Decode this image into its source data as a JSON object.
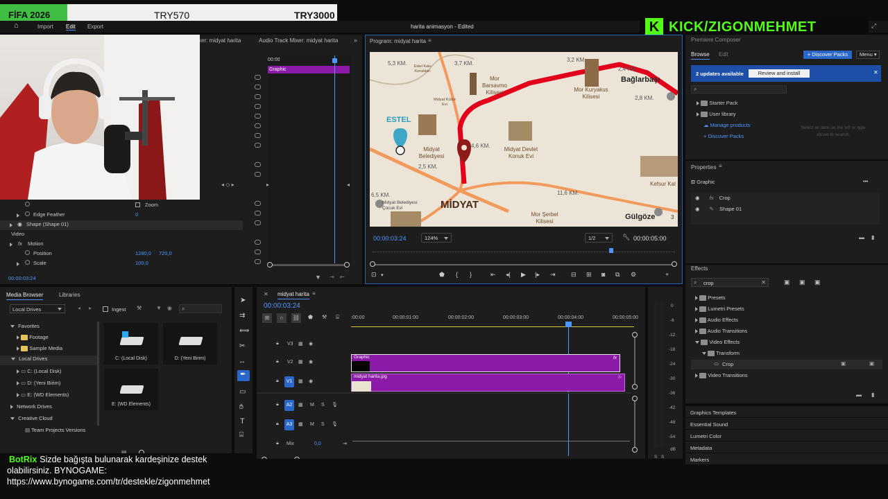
{
  "overlay_banner": {
    "game": "FİFA 2026",
    "price1": "TRY570",
    "price2": "TRY3000"
  },
  "kick_logo": {
    "letter": "K",
    "text": "KICK/ZIGONMEHMET"
  },
  "menu": {
    "home": "⌂",
    "items": [
      "Import",
      "Edit",
      "Export"
    ],
    "active": "Edit",
    "doc_title": "harita animasyon",
    "doc_state": " - Edited"
  },
  "effect_controls": {
    "tab_a": "xer: midyat harita",
    "tab_b": "Audio Track Mixer: midyat harita",
    "mini_tl_time": "00:00",
    "clip_label": "Graphic",
    "rows": [
      {
        "label": "Zoom",
        "value": ""
      },
      {
        "label": "Edge Feather",
        "value": "0"
      },
      {
        "label": "Shape (Shape 01)",
        "value": ""
      },
      {
        "label": "Video",
        "value": ""
      },
      {
        "label": "Motion",
        "value": ""
      },
      {
        "label": "Position",
        "value": "1280,0",
        "value2": "720,0"
      },
      {
        "label": "Scale",
        "value": "100,0"
      }
    ],
    "fx_glyph": "fx",
    "timecode": "00:00:03:24"
  },
  "program": {
    "title": "Program: midyat harita",
    "timecode": "00:00:03:24",
    "zoom": "124%",
    "quality": "1/2",
    "duration": "00:00:05:00",
    "map_labels": {
      "d1": "5,3 KM.",
      "d2": "3,7 KM.",
      "d3": "3,2 KM.",
      "d4": "2,4 KM.",
      "d5": "2,8 KM.",
      "d6": "4,6 KM.",
      "d7": "2,5 KM.",
      "d8": "11,6 KM.",
      "d9": "6,5 KM.",
      "estel": "ESTEL",
      "midyat": "MİDYAT",
      "baglarbasi": "Bağlarbaşı",
      "gulgoze": "Gülgöze",
      "belediyesi": "Midyat Belediyesi",
      "devlet": "Midyat Devlet Konuk Evi",
      "barsavmo": "Mor Barsavmo Kilisesi",
      "kuryakus": "Mor Kuryakus Kilisesi",
      "serbel": "Mor Şerbel Kilisesi",
      "cocuk": "Midyat Belediyesi Çocuk Evi",
      "kefsur": "Kefsur Kal",
      "estel_kale": "Estel Kale Konakları",
      "kultur": "Midyat Kültür Evi",
      "num3": "3"
    }
  },
  "essential_graphics": {
    "header": "Premiere Composer",
    "tabs": [
      "Browse",
      "Edit"
    ],
    "discover_btn": "+ Discover Packs",
    "menu_btn": "Menu",
    "updates": "2 updates available",
    "review_btn": "Review and install",
    "tree": [
      "Starter Pack",
      "User library",
      "Manage products",
      "+ Discover Packs"
    ],
    "hint": "Select an item on the left or type above to search."
  },
  "properties": {
    "title": "Properties",
    "item": "Graphic",
    "rows": [
      "Crop",
      "Shape 01"
    ],
    "more": "•••"
  },
  "effects": {
    "title": "Effects",
    "search": "crop",
    "tree": [
      {
        "label": "Presets",
        "indent": 0,
        "open": false
      },
      {
        "label": "Lumetri Presets",
        "indent": 0,
        "open": false
      },
      {
        "label": "Audio Effects",
        "indent": 0,
        "open": false
      },
      {
        "label": "Audio Transitions",
        "indent": 0,
        "open": false
      },
      {
        "label": "Video Effects",
        "indent": 0,
        "open": true
      },
      {
        "label": "Transform",
        "indent": 1,
        "open": true
      },
      {
        "label": "Crop",
        "indent": 2,
        "open": false
      },
      {
        "label": "Video Transitions",
        "indent": 0,
        "open": false
      }
    ],
    "collapsed_panels": [
      "Graphics Templates",
      "Essential Sound",
      "Lumetri Color",
      "Metadata",
      "Markers"
    ]
  },
  "media_browser": {
    "tabs": [
      "Media Browser",
      "Libraries"
    ],
    "drive_select": "Local Drives",
    "ingest": "Ingest",
    "tree": [
      {
        "label": "Favorites",
        "indent": 0
      },
      {
        "label": "Footage",
        "indent": 1
      },
      {
        "label": "Sample Media",
        "indent": 1
      },
      {
        "label": "Local Drives",
        "indent": 0
      },
      {
        "label": "C: (Local Disk)",
        "indent": 1
      },
      {
        "label": "D: (Yeni Birim)",
        "indent": 1
      },
      {
        "label": "E: (WD Elements)",
        "indent": 1
      },
      {
        "label": "Network Drives",
        "indent": 0
      },
      {
        "label": "Creative Cloud",
        "indent": 0
      },
      {
        "label": "Team Projects Versions",
        "indent": 1
      }
    ],
    "drives": [
      "C: (Local Disk)",
      "D: (Yeni Birim)",
      "E: (WD Elements)"
    ]
  },
  "timeline": {
    "title": "midyat harita",
    "timecode": "00:00:03:24",
    "ruler": [
      ":00:00",
      "00:00:01:00",
      "00:00:02:00",
      "00:00:03:00",
      "00:00:04:00",
      "00:00:05:00"
    ],
    "tracks": [
      {
        "id": "V3",
        "kind": "video"
      },
      {
        "id": "V2",
        "kind": "video"
      },
      {
        "id": "V1",
        "kind": "video"
      },
      {
        "id": "A2",
        "kind": "audio"
      },
      {
        "id": "A3",
        "kind": "audio"
      }
    ],
    "mix": "Mix",
    "mix_value": "0,0",
    "clips": [
      {
        "track": "V2",
        "label": "Graphic"
      },
      {
        "track": "V1",
        "label": "midyat harita.jpg"
      }
    ],
    "fx_badge": "fx",
    "ms_labels": [
      "M",
      "S"
    ]
  },
  "audio_meter": {
    "scale": [
      "0",
      "-6",
      "-12",
      "-18",
      "-24",
      "-30",
      "-36",
      "-42",
      "-48",
      "-54",
      "dB"
    ],
    "footer": [
      "S",
      "S"
    ]
  },
  "chat": {
    "user": "BotRix",
    "message": "Sizde bağışta bulunarak kardeşinize destek olabilirsiniz. BYNOGAME: https://www.bynogame.com/tr/destekle/zigonmehmet"
  },
  "colors": {
    "accent": "#4d97ff",
    "clip": "#8b1aa8",
    "kick": "#53fc18",
    "route": "#e3001b",
    "banner_green": "#3fbe43"
  }
}
